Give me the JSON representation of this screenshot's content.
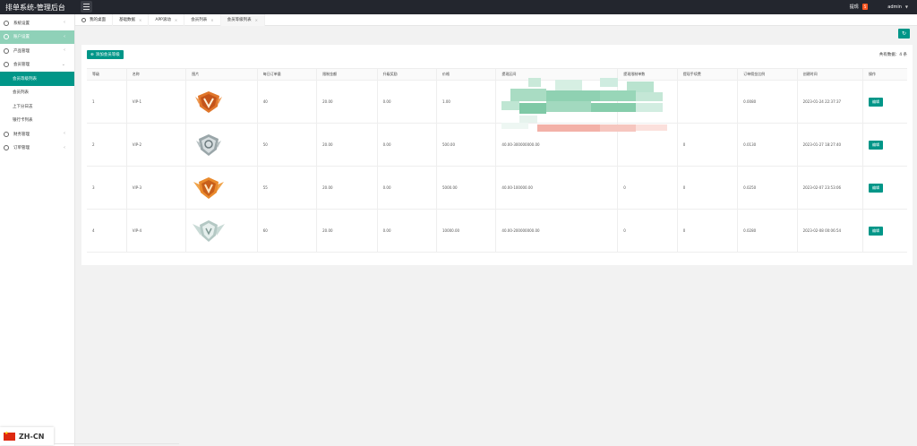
{
  "app": {
    "title": "排单系统-管理后台"
  },
  "topbar": {
    "notice_label": "提现",
    "notice_count": "5",
    "user": "admin"
  },
  "sidebar": {
    "items": [
      {
        "label": "系统设置"
      },
      {
        "label": "账户设置"
      },
      {
        "label": "产品管理"
      },
      {
        "label": "会员管理"
      },
      {
        "label": "财务管理"
      },
      {
        "label": "订单管理"
      }
    ],
    "sub": [
      {
        "label": "会员等级列表"
      },
      {
        "label": "会员列表"
      },
      {
        "label": "上下分日志"
      },
      {
        "label": "银行卡列表"
      }
    ]
  },
  "tabs": [
    {
      "label": "我的桌面"
    },
    {
      "label": "基础数据"
    },
    {
      "label": "APP滚动"
    },
    {
      "label": "会员列表"
    },
    {
      "label": "会员等级列表"
    }
  ],
  "toolbar": {
    "add_label": "添加会员等级",
    "count_text": "共有数据：4 条"
  },
  "table": {
    "headers": [
      "等级",
      "名称",
      "图片",
      "每日订单量",
      "限制金额",
      "升级奖励",
      "价格",
      "提现区间",
      "提现限制单数",
      "提现手续费",
      "订单佣金比例",
      "创建时间",
      "操作"
    ],
    "rows": [
      {
        "level": "1",
        "name": "VIP-1",
        "orders": "40",
        "limit": "20.00",
        "bonus": "0.00",
        "price": "1.00",
        "range": "",
        "count": "",
        "fee": "",
        "ratio": "0.0080",
        "created": "2023-01-24 22:37:37",
        "op": "编辑"
      },
      {
        "level": "2",
        "name": "VIP-2",
        "orders": "50",
        "limit": "20.00",
        "bonus": "0.00",
        "price": "500.00",
        "range": "40.00-300000000.00",
        "count": "",
        "fee": "0",
        "ratio": "0.0130",
        "created": "2023-01-27 18:27:40",
        "op": "编辑"
      },
      {
        "level": "3",
        "name": "VIP-3",
        "orders": "55",
        "limit": "20.00",
        "bonus": "0.00",
        "price": "5000.00",
        "range": "40.00-100000.00",
        "count": "0",
        "fee": "0",
        "ratio": "0.0250",
        "created": "2023-02-07 23:53:06",
        "op": "编辑"
      },
      {
        "level": "4",
        "name": "VIP-4",
        "orders": "60",
        "limit": "20.00",
        "bonus": "0.00",
        "price": "10000.00",
        "range": "40.00-200000000.00",
        "count": "0",
        "fee": "0",
        "ratio": "0.0280",
        "created": "2023-02-08 00:06:54",
        "op": "编辑"
      }
    ]
  },
  "language": {
    "label": "ZH-CN"
  },
  "colors": {
    "accent": "#009688",
    "sidebar_active": "#8fd1b8",
    "topbar": "#23262e"
  }
}
